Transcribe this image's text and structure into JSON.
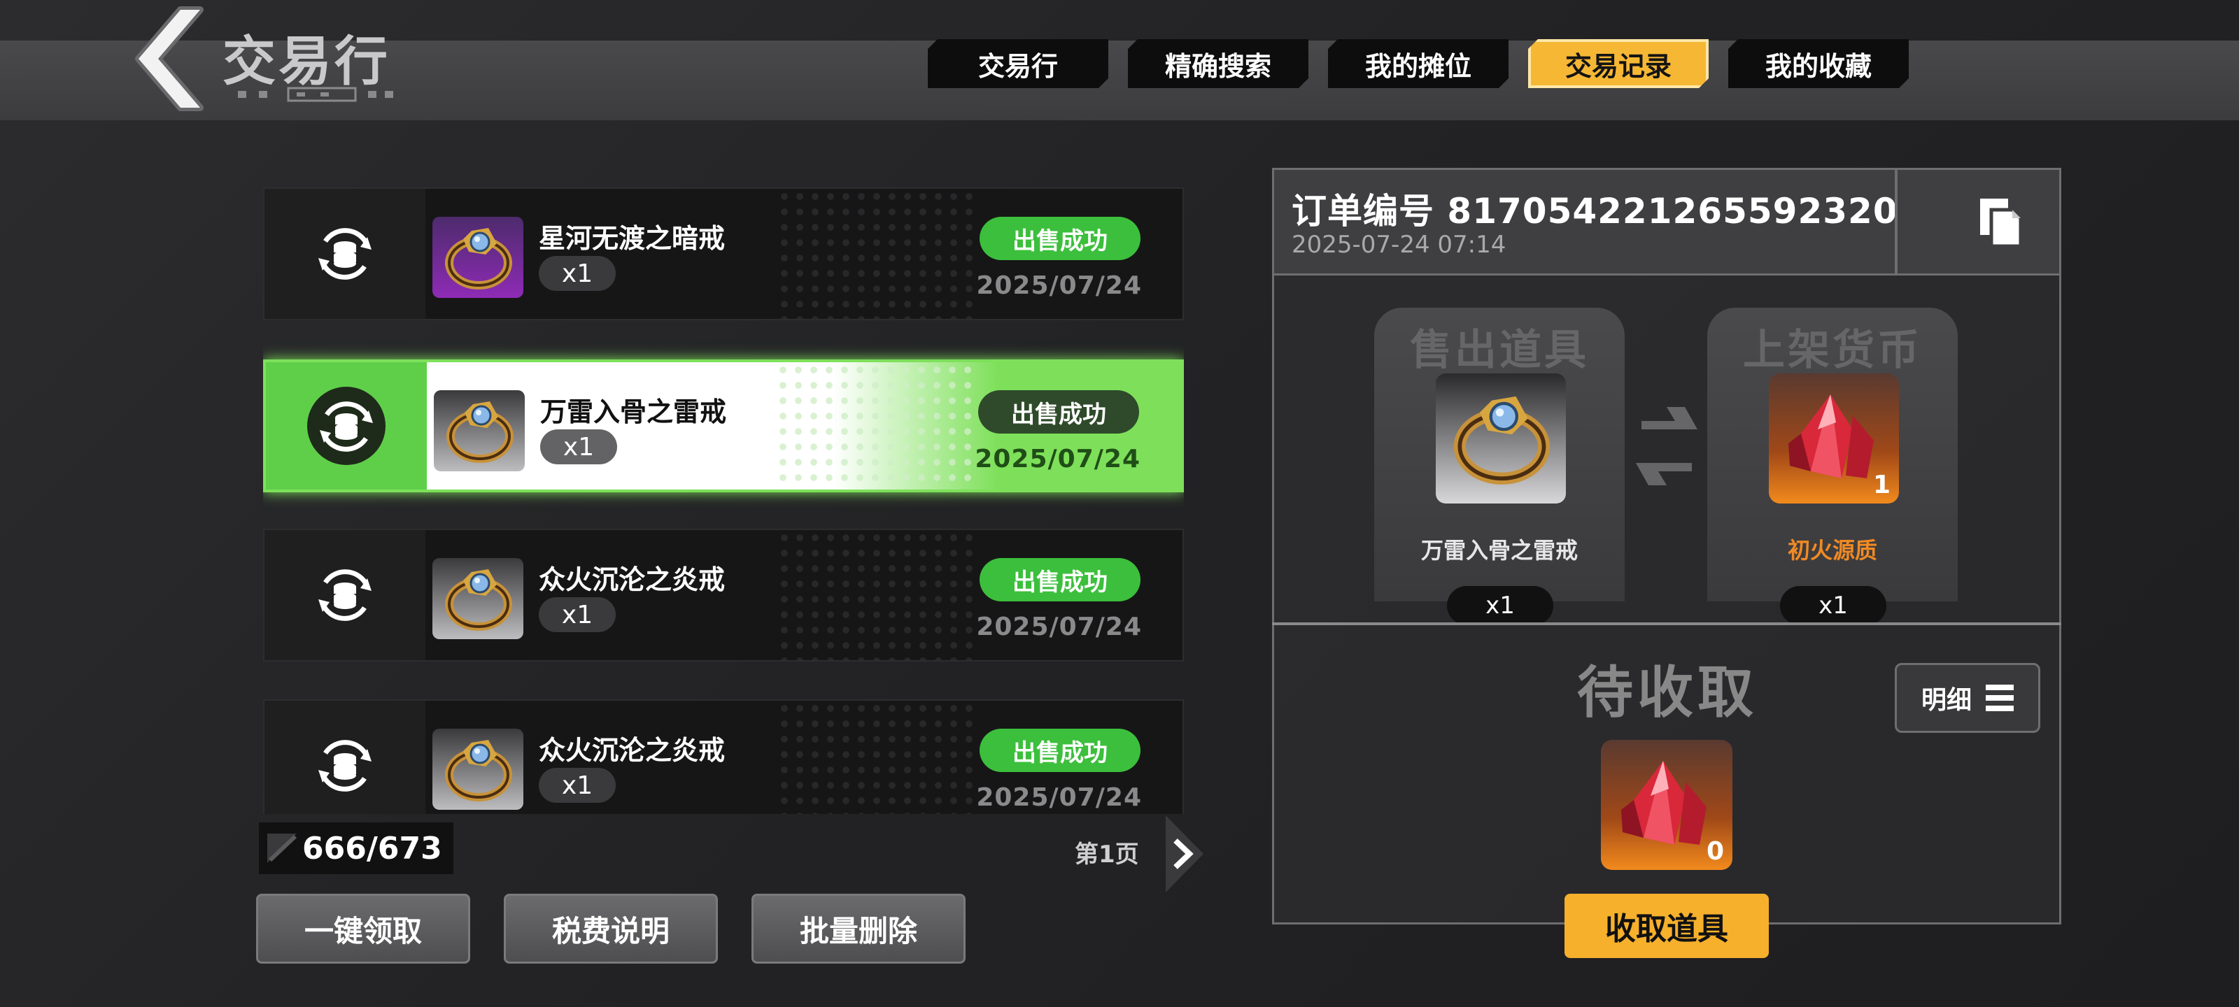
{
  "header": {
    "title": "交易行",
    "tabs": [
      {
        "label": "交易行",
        "active": false
      },
      {
        "label": "精确搜索",
        "active": false
      },
      {
        "label": "我的摊位",
        "active": false
      },
      {
        "label": "交易记录",
        "active": true
      },
      {
        "label": "我的收藏",
        "active": false
      }
    ]
  },
  "records": [
    {
      "name": "星河无渡之暗戒",
      "qty": "x1",
      "status": "出售成功",
      "date": "2025/07/24",
      "rarity": "purple"
    },
    {
      "name": "万雷入骨之雷戒",
      "qty": "x1",
      "status": "出售成功",
      "date": "2025/07/24",
      "rarity": "gray",
      "selected": true
    },
    {
      "name": "众火沉沦之炎戒",
      "qty": "x1",
      "status": "出售成功",
      "date": "2025/07/24",
      "rarity": "gray"
    },
    {
      "name": "众火沉沦之炎戒",
      "qty": "x1",
      "status": "出售成功",
      "date": "2025/07/24",
      "rarity": "gray"
    }
  ],
  "list_footer": {
    "count": "666/673",
    "page_label": "第1页"
  },
  "actions": {
    "claim_all": "一键领取",
    "tax_info": "税费说明",
    "batch_delete": "批量删除"
  },
  "detail": {
    "order_number": "订单编号 817054221265592320",
    "order_time": "2025-07-24 07:14",
    "sold_title": "售出道具",
    "sold_item_name": "万雷入骨之雷戒",
    "sold_qty": "x1",
    "currency_title": "上架货币",
    "currency_name": "初火源质",
    "currency_qty": "x1",
    "currency_stack": "1",
    "pending_title": "待收取",
    "detail_button": "明细",
    "pending_count": "0",
    "collect_button": "收取道具"
  },
  "colors": {
    "accent": "#f6b735",
    "success": "#3cbf3c",
    "selected_glow": "#7ee05a",
    "currency_text": "#f08a24"
  },
  "icons": [
    "back-arrow-icon",
    "coin-exchange-icon",
    "ring-icon",
    "crystal-icon",
    "copy-icon",
    "list-icon",
    "chevron-right-icon",
    "swap-arrows-icon"
  ]
}
